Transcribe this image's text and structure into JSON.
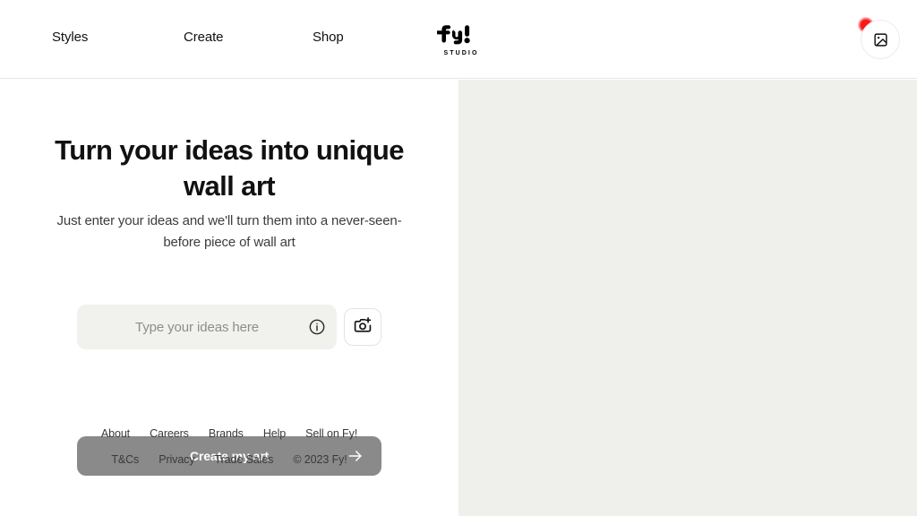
{
  "header": {
    "nav": [
      {
        "label": "Styles",
        "name": "nav-item-styles"
      },
      {
        "label": "Create",
        "name": "nav-item-create"
      },
      {
        "label": "Shop",
        "name": "nav-item-shop"
      }
    ],
    "logo": {
      "mark": "fy!",
      "subtitle": "STUDIO"
    },
    "account_button": {
      "icon": "image-icon",
      "has_notification": true,
      "notification_color": "#fb1818"
    }
  },
  "hero": {
    "title": "Turn your ideas into unique wall art",
    "subtitle": "Just enter your ideas and we'll turn them into a never-seen-before piece of wall art",
    "input": {
      "value": "",
      "placeholder": "Type your ideas here",
      "info_icon": "info-circle-icon"
    },
    "camera_button": {
      "icon": "camera-plus-icon",
      "label": ""
    },
    "cta": {
      "label": "Create my art",
      "arrow_icon": "arrow-right-icon",
      "background": "#8a8a8a"
    }
  },
  "footer": {
    "primary_links": [
      {
        "label": "About",
        "name": "footer-link-about"
      },
      {
        "label": "Careers",
        "name": "footer-link-careers"
      },
      {
        "label": "Brands",
        "name": "footer-link-brands"
      },
      {
        "label": "Help",
        "name": "footer-link-help"
      },
      {
        "label": "Sell on Fy!",
        "name": "footer-link-sell-on-fy"
      }
    ],
    "secondary_links": [
      {
        "label": "T&Cs",
        "name": "footer-link-tcs"
      },
      {
        "label": "Privacy",
        "name": "footer-link-privacy"
      },
      {
        "label": "Trade Sales",
        "name": "footer-link-trade-sales"
      }
    ],
    "copyright": "© 2023 Fy!"
  },
  "preview_panel": {
    "background": "#efefec",
    "content": ""
  },
  "colors": {
    "page_background": "#ffffff",
    "panel_background": "#efefec",
    "input_background": "#f1f1ee",
    "cta_background": "#8a8a8a",
    "text_primary": "#111111",
    "text_secondary": "#3d3d3d",
    "accent_red": "#fb1818"
  }
}
